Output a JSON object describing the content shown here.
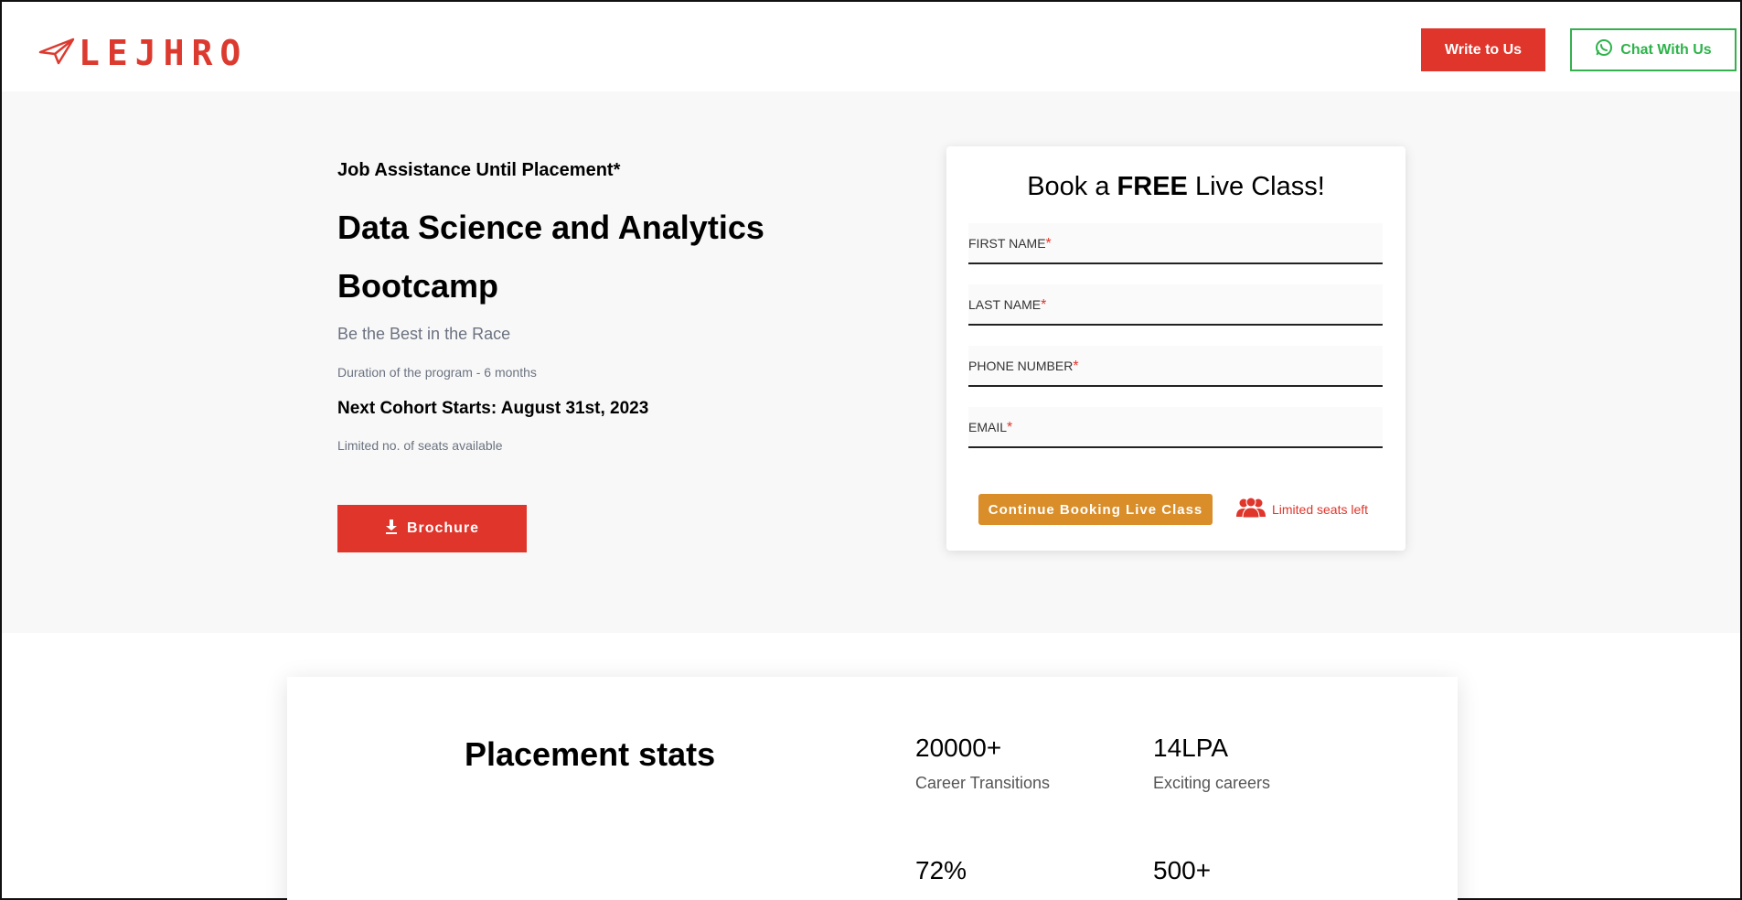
{
  "header": {
    "logo_text": "LEJHRO",
    "write_button": "Write to Us",
    "chat_button": "Chat With Us"
  },
  "hero": {
    "tagline": "Job Assistance Until Placement*",
    "title": "Data Science and Analytics Bootcamp",
    "subtitle": "Be the Best in the Race",
    "duration": "Duration of the program - 6 months",
    "cohort": "Next Cohort Starts: August 31st, 2023",
    "seats_note": "Limited no. of seats available",
    "brochure_button": "Brochure"
  },
  "form": {
    "title_prefix": "Book a ",
    "title_bold": "FREE",
    "title_suffix": " Live Class!",
    "fields": [
      {
        "label": "FIRST NAME",
        "required_mark": "*"
      },
      {
        "label": "LAST NAME",
        "required_mark": "*"
      },
      {
        "label": "PHONE NUMBER",
        "required_mark": "*"
      },
      {
        "label": "EMAIL",
        "required_mark": "*"
      }
    ],
    "submit_button": "Continue Booking Live Class",
    "limited_seats": "Limited seats left"
  },
  "stats": {
    "heading": "Placement stats",
    "items": [
      {
        "value": "20000+",
        "label": "Career Transitions"
      },
      {
        "value": "14LPA",
        "label": "Exciting careers"
      },
      {
        "value": "72%",
        "label": ""
      },
      {
        "value": "500+",
        "label": ""
      }
    ]
  },
  "colors": {
    "brand_red": "#e0352b",
    "whatsapp_green": "#36b04f",
    "cta_orange": "#d98e2a",
    "hero_bg": "#f8f8f8"
  }
}
